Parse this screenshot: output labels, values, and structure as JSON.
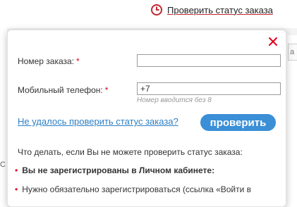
{
  "topbar": {
    "status_link": "Проверить статус заказа",
    "status_icon": "clock-icon",
    "accent_color": "#c1272d"
  },
  "popup": {
    "order_label": "Номер заказа:",
    "order_required": "*",
    "order_value": "",
    "phone_label": "Мобильный телефон:",
    "phone_required": "*",
    "phone_value": "+7",
    "phone_hint": "Номер вводится без 8",
    "fail_link": "Не удалось проверить статус заказа?",
    "check_button": "проверить",
    "info_text": "Что делать, если Вы не можете проверить статус заказа:",
    "bullets": [
      "Вы не зарегистрированы в Личном кабинете:",
      "Нужно обязательно зарегистрироваться (ссылка «Войти в"
    ],
    "close_icon": "close-icon",
    "close_color": "#e0001b",
    "button_color": "#3a8fd6",
    "link_color": "#2d7fc4"
  },
  "background": {
    "right_tab": "а",
    "left_mark": "С"
  }
}
